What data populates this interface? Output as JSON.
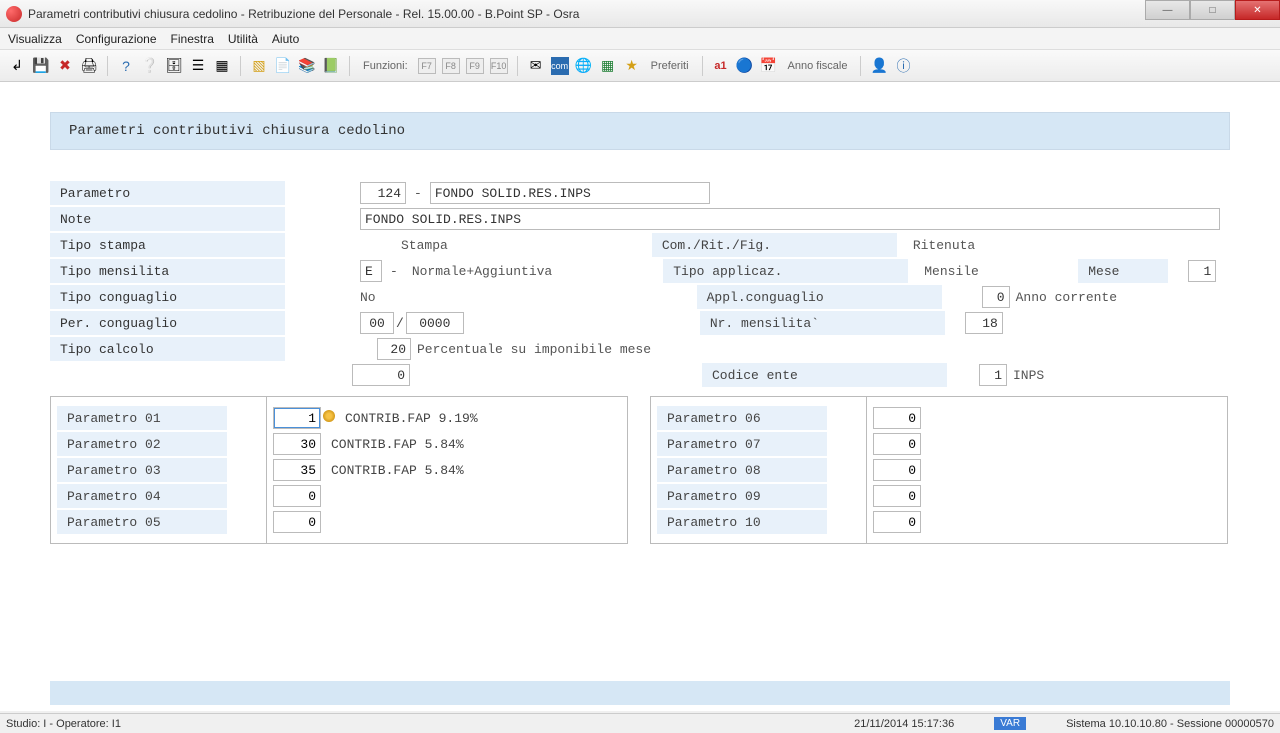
{
  "window": {
    "title": "Parametri contributivi chiusura cedolino - Retribuzione del Personale - Rel. 15.00.00 - B.Point SP - Osra"
  },
  "menu": {
    "visualizza": "Visualizza",
    "configurazione": "Configurazione",
    "finestra": "Finestra",
    "utilita": "Utilità",
    "aiuto": "Aiuto"
  },
  "toolbar": {
    "funzioni_label": "Funzioni:",
    "keys": [
      "F7",
      "F8",
      "F9",
      "F10"
    ],
    "preferiti": "Preferiti",
    "anno_fiscale": "Anno fiscale"
  },
  "panel": {
    "title": "Parametri contributivi chiusura cedolino"
  },
  "fields": {
    "parametro_label": "Parametro",
    "parametro_val": "124",
    "parametro_desc": "FONDO SOLID.RES.INPS",
    "note_label": "Note",
    "note_val": "FONDO SOLID.RES.INPS",
    "tipo_stampa_label": "Tipo stampa",
    "tipo_stampa_desc": "Stampa",
    "com_rit_fig_label": "Com./Rit./Fig.",
    "com_rit_fig_desc": "Ritenuta",
    "tipo_mensilita_label": "Tipo mensilita",
    "tipo_mensilita_val": "E",
    "tipo_mensilita_desc": "Normale+Aggiuntiva",
    "tipo_applicaz_label": "Tipo applicaz.",
    "tipo_applicaz_desc": "Mensile",
    "mese_label": "Mese",
    "mese_val": "1",
    "tipo_conguaglio_label": "Tipo conguaglio",
    "tipo_conguaglio_desc": "No",
    "appl_conguaglio_label": "Appl.conguaglio",
    "appl_conguaglio_val": "0",
    "appl_conguaglio_desc": "Anno corrente",
    "per_conguaglio_label": "Per. conguaglio",
    "per_conguaglio_mm": "00",
    "per_conguaglio_yyyy": "0000",
    "nr_mensilita_label": "Nr. mensilita`",
    "nr_mensilita_val": "18",
    "tipo_calcolo_label": "Tipo calcolo",
    "tipo_calcolo_val": "20",
    "tipo_calcolo_desc": "Percentuale su imponibile mese",
    "secondary_val": "0",
    "codice_ente_label": "Codice ente",
    "codice_ente_val": "1",
    "codice_ente_desc": "INPS"
  },
  "params_left": [
    {
      "label": "Parametro 01",
      "val": "1",
      "desc": "CONTRIB.FAP 9.19%"
    },
    {
      "label": "Parametro 02",
      "val": "30",
      "desc": "CONTRIB.FAP 5.84%"
    },
    {
      "label": "Parametro 03",
      "val": "35",
      "desc": "CONTRIB.FAP 5.84%"
    },
    {
      "label": "Parametro 04",
      "val": "0",
      "desc": ""
    },
    {
      "label": "Parametro 05",
      "val": "0",
      "desc": ""
    }
  ],
  "params_right": [
    {
      "label": "Parametro 06",
      "val": "0"
    },
    {
      "label": "Parametro 07",
      "val": "0"
    },
    {
      "label": "Parametro 08",
      "val": "0"
    },
    {
      "label": "Parametro 09",
      "val": "0"
    },
    {
      "label": "Parametro 10",
      "val": "0"
    }
  ],
  "status": {
    "left": "Studio: I - Operatore: I1",
    "datetime": "21/11/2014   15:17:36",
    "var": "VAR",
    "right": "Sistema 10.10.10.80 - Sessione 00000570"
  }
}
